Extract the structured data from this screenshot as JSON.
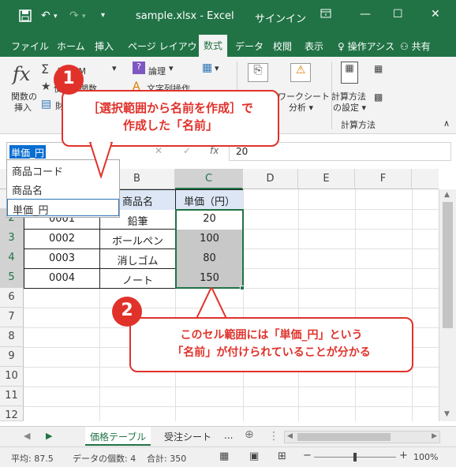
{
  "titlebar": {
    "filename": "sample.xlsx",
    "sep": "-",
    "app": "Excel",
    "signin": "サインイン",
    "save_icon": "save-icon",
    "undo_icon": "undo-icon",
    "redo_icon": "redo-icon",
    "minimize": "—",
    "restore": "☐",
    "close": "✕"
  },
  "tabs": [
    {
      "label": "ファイル"
    },
    {
      "label": "ホーム"
    },
    {
      "label": "挿入"
    },
    {
      "label": "ページ レイアウト"
    },
    {
      "label": "数式",
      "active": true
    },
    {
      "label": "データ"
    },
    {
      "label": "校閲"
    },
    {
      "label": "表示"
    },
    {
      "label": "操作アシス"
    }
  ],
  "share_label": "共有",
  "ribbon": {
    "fx_label_1": "関数の",
    "fx_label_2": "挿入",
    "autosum": "ト SUM",
    "recent": "使った関数",
    "financial": "財",
    "logical": "論理",
    "text": "文字列操作",
    "worksheet_1": "ワークシート",
    "worksheet_2": "分析",
    "calc_1": "計算方法",
    "calc_2": "の設定",
    "calc_group": "計算方法"
  },
  "formula_bar": {
    "name_box": "単価_円",
    "cancel": "✕",
    "enter": "✓",
    "fx": "fx",
    "value": "20"
  },
  "name_dropdown": [
    "商品コード",
    "商品名",
    "単価_円"
  ],
  "columns": [
    "A",
    "B",
    "C",
    "D",
    "E",
    "F"
  ],
  "rows": [
    "1",
    "2",
    "3",
    "4",
    "5",
    "6",
    "7",
    "8",
    "9",
    "10",
    "11",
    "12"
  ],
  "table": {
    "headers": [
      "商品名",
      "単価（円）"
    ],
    "rows": [
      [
        "0001",
        "鉛筆",
        "20"
      ],
      [
        "0002",
        "ボールペン",
        "100"
      ],
      [
        "0003",
        "消しゴム",
        "80"
      ],
      [
        "0004",
        "ノート",
        "150"
      ]
    ]
  },
  "sheets": {
    "tabs": [
      "価格テーブル",
      "受注シート"
    ],
    "more": "...",
    "add": "⊕"
  },
  "status": {
    "average": "平均: 87.5",
    "count": "データの個数: 4",
    "sum": "合計: 350",
    "zoom": "100%",
    "minus": "−",
    "plus": "+"
  },
  "callouts": {
    "badge1": "1",
    "text1_line1": "［選択範囲から名前を作成］で",
    "text1_line2": "作成した「名前」",
    "badge2": "2",
    "text2_line1": "このセル範囲には「単価_円」という",
    "text2_line2": "「名前」が付けられていることが分かる"
  },
  "colors": {
    "excel_green": "#217346",
    "callout_red": "#e0322b",
    "selection_blue": "#0a6ed1",
    "selected_fill": "#c8c8c8"
  }
}
